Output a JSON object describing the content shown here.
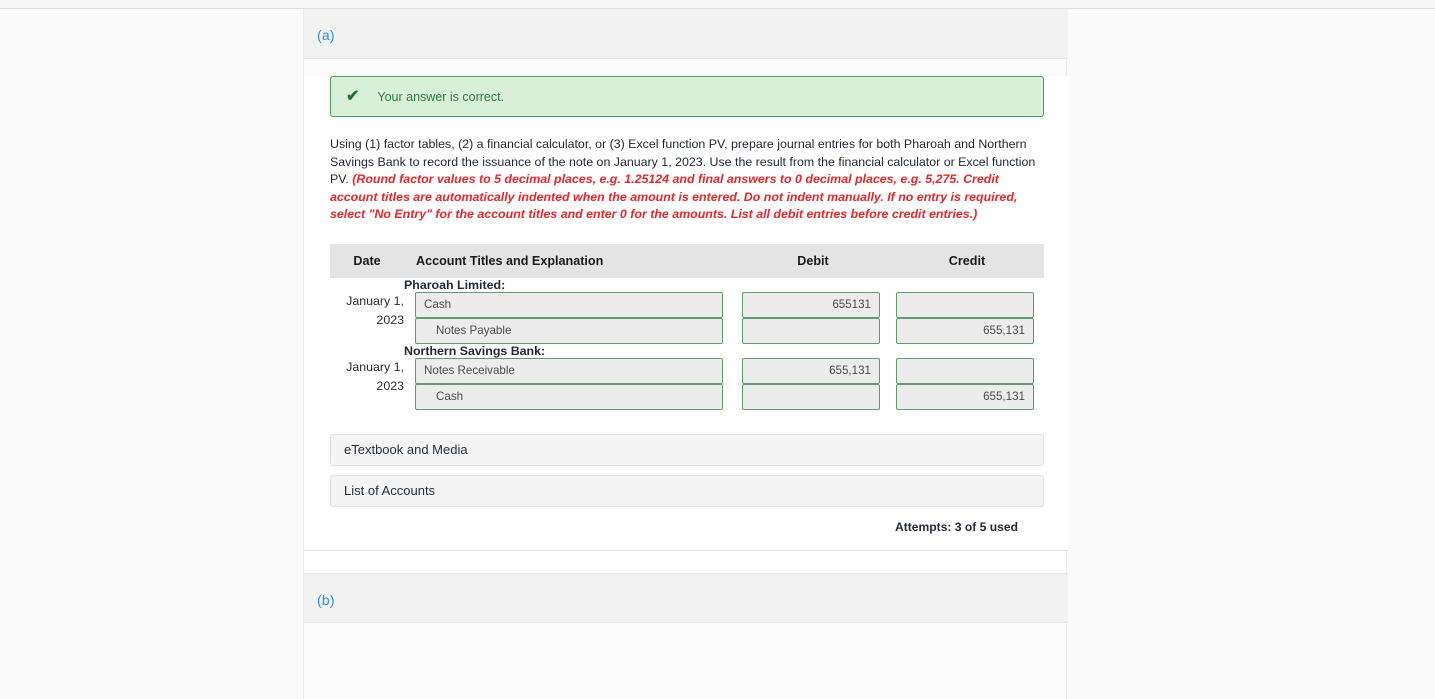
{
  "parts": {
    "a": {
      "label": "(a)",
      "alert": {
        "icon": "check-icon",
        "text": "Your answer is correct."
      },
      "instructions": {
        "body": "Using (1) factor tables, (2) a financial calculator, or (3) Excel function PV, prepare journal entries for both Pharoah and Northern Savings Bank to record the issuance of the note on January 1, 2023. Use the result from the financial calculator or Excel function PV. ",
        "hint": "(Round factor values to 5 decimal places, e.g. 1.25124 and final answers to 0 decimal places, e.g. 5,275. Credit account titles are automatically indented when the amount is entered. Do not indent manually. If no entry is required, select \"No Entry\" for the account titles and enter 0 for the amounts. List all debit entries before credit entries.)"
      },
      "table": {
        "headers": {
          "date": "Date",
          "account": "Account Titles and Explanation",
          "debit": "Debit",
          "credit": "Credit"
        },
        "sections": [
          {
            "company": "Pharoah Limited:",
            "date": "January 1, 2023",
            "rows": [
              {
                "account": "Cash",
                "indented": false,
                "debit": "655131",
                "credit": ""
              },
              {
                "account": "Notes Payable",
                "indented": true,
                "debit": "",
                "credit": "655,131"
              }
            ]
          },
          {
            "company": "Northern Savings Bank:",
            "date": "January 1, 2023",
            "rows": [
              {
                "account": "Notes Receivable",
                "indented": false,
                "debit": "655,131",
                "credit": ""
              },
              {
                "account": "Cash",
                "indented": true,
                "debit": "",
                "credit": "655,131"
              }
            ]
          }
        ]
      },
      "buttons": {
        "etextbook": "eTextbook and Media",
        "list_of_accounts": "List of Accounts"
      },
      "attempts": "Attempts: 3 of 5 used"
    },
    "b": {
      "label": "(b)"
    }
  },
  "colors": {
    "accent_blue": "#2a8fd4",
    "success_bg": "#d8f0d8",
    "success_border": "#4f9e5a",
    "success_text": "#2e7a3d",
    "hint_red": "#e8262a",
    "field_border": "#5f9e6c",
    "field_bg": "#ececec",
    "header_bg": "#e4e4e4"
  }
}
